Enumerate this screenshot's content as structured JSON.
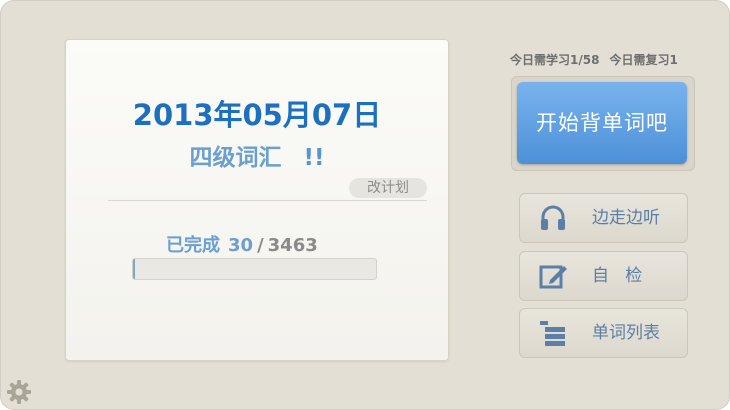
{
  "card": {
    "date": "2013年05月07日",
    "vocab_name": "四级词汇",
    "vocab_alert": "!!",
    "change_plan": "改计划",
    "progress_label": "已完成",
    "progress_done": "30",
    "progress_sep": "/",
    "progress_total": "3463",
    "progress_fraction": 0.0087
  },
  "stats": {
    "today_learn": "今日需学习1/58",
    "today_review": "今日需复习1"
  },
  "buttons": {
    "start": "开始背单词吧",
    "listen": "边走边听",
    "self_check": "自   检",
    "word_list": "单词列表"
  },
  "icons": {
    "listen": "headphones-icon",
    "self_check": "edit-icon",
    "word_list": "list-stack-icon",
    "settings": "gear-icon"
  },
  "colors": {
    "accent": "#1d6fc0",
    "button_blue": "#4d90d7",
    "icon_blue": "#5b7fa6"
  }
}
